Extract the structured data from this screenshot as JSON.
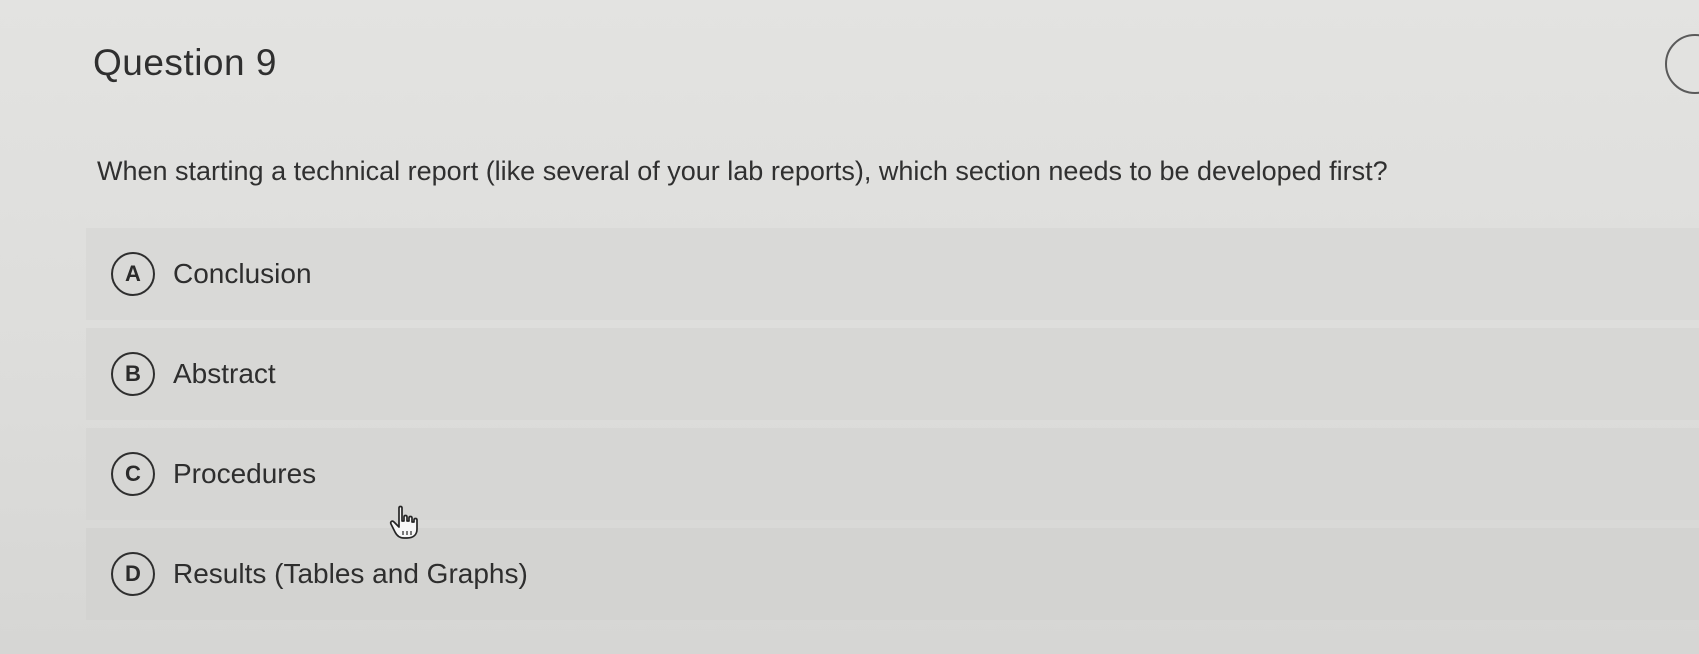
{
  "question": {
    "title": "Question 9",
    "text": "When starting a technical report (like several of your lab reports), which section needs to be developed first?"
  },
  "options": [
    {
      "letter": "A",
      "label": "Conclusion"
    },
    {
      "letter": "B",
      "label": "Abstract"
    },
    {
      "letter": "C",
      "label": "Procedures"
    },
    {
      "letter": "D",
      "label": "Results (Tables and Graphs)"
    }
  ],
  "icons": {
    "cursor": "hand-pointer-icon"
  },
  "colors": {
    "background": "#dddddb",
    "option_background": "#d8d8d6",
    "text": "#2e2e2e"
  }
}
